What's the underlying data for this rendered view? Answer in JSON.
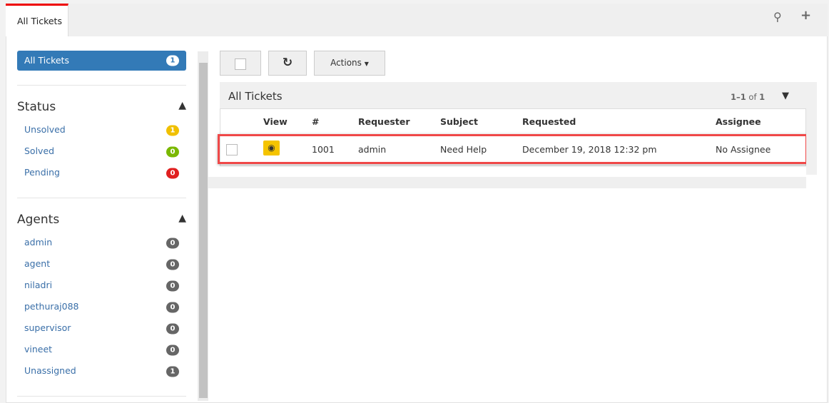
{
  "tab": {
    "label": "All Tickets"
  },
  "toolbar": {
    "search_icon": "search-icon",
    "add_icon": "plus-icon"
  },
  "sidebar": {
    "all": {
      "label": "All Tickets",
      "count": "1"
    },
    "status": {
      "title": "Status",
      "items": [
        {
          "label": "Unsolved",
          "count": "1",
          "color": "#f0c000"
        },
        {
          "label": "Solved",
          "count": "0",
          "color": "#7ab800"
        },
        {
          "label": "Pending",
          "count": "0",
          "color": "#e02020"
        }
      ]
    },
    "agents": {
      "title": "Agents",
      "items": [
        {
          "label": "admin",
          "count": "0"
        },
        {
          "label": "agent",
          "count": "0"
        },
        {
          "label": "niladri",
          "count": "0"
        },
        {
          "label": "pethuraj088",
          "count": "0"
        },
        {
          "label": "supervisor",
          "count": "0"
        },
        {
          "label": "vineet",
          "count": "0"
        },
        {
          "label": "Unassigned",
          "count": "1"
        }
      ]
    }
  },
  "actions": {
    "label": "Actions"
  },
  "table": {
    "title": "All Tickets",
    "pagination": "1–1",
    "of": "of",
    "total": "1",
    "columns": [
      "View",
      "#",
      "Requester",
      "Subject",
      "Requested",
      "Assignee"
    ],
    "rows": [
      {
        "id": "1001",
        "requester": "admin",
        "subject": "Need Help",
        "requested": "December 19, 2018 12:32 pm",
        "assignee": "No Assignee"
      }
    ]
  }
}
